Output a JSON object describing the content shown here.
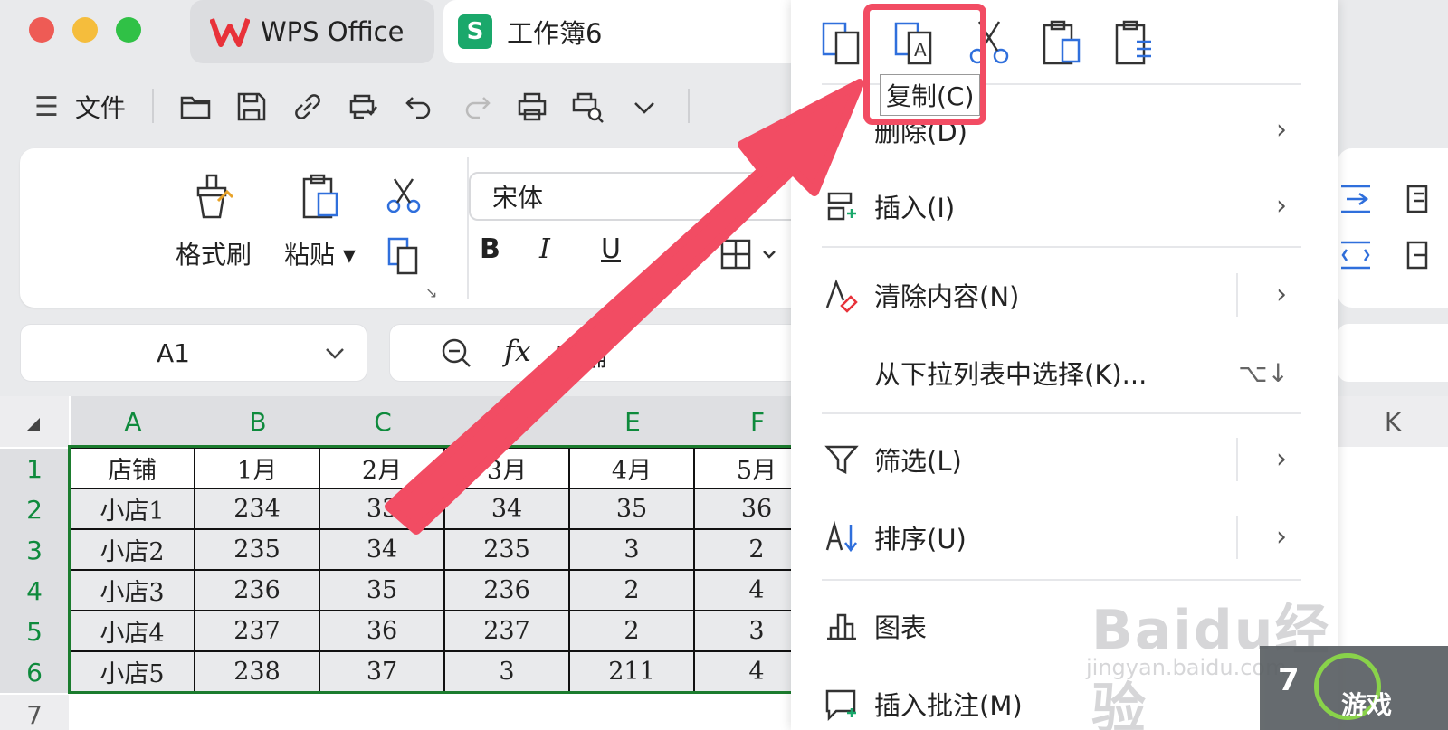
{
  "titlebar": {
    "tabs": [
      {
        "label": "WPS Office"
      },
      {
        "label": "工作簿6"
      }
    ]
  },
  "quickbar": {
    "menu_label": "文件"
  },
  "ribbon": {
    "format_painter_label": "格式刷",
    "paste_label": "粘贴",
    "font_name": "宋体",
    "bold": "B",
    "italic": "I",
    "underline": "U"
  },
  "formula_bar": {
    "cell_ref": "A1",
    "fx": "fx",
    "value": "店铺"
  },
  "sheet": {
    "columns": [
      "A",
      "B",
      "C",
      "D",
      "E",
      "F"
    ],
    "right_column": "K",
    "row_numbers": [
      "1",
      "2",
      "3",
      "4",
      "5",
      "6",
      "7"
    ],
    "rows": [
      [
        "店铺",
        "1月",
        "2月",
        "3月",
        "4月",
        "5月"
      ],
      [
        "小店1",
        "234",
        "33",
        "34",
        "35",
        "36"
      ],
      [
        "小店2",
        "235",
        "34",
        "235",
        "3",
        "2"
      ],
      [
        "小店3",
        "236",
        "35",
        "236",
        "2",
        "4"
      ],
      [
        "小店4",
        "237",
        "36",
        "237",
        "2",
        "3"
      ],
      [
        "小店5",
        "238",
        "37",
        "3",
        "211",
        "4"
      ]
    ]
  },
  "context_menu": {
    "tooltip": "复制(C)",
    "items": [
      {
        "label": "删除(D)",
        "icon": "delete-icon"
      },
      {
        "label": "插入(I)",
        "icon": "insert-icon"
      },
      {
        "label": "清除内容(N)",
        "icon": "clear-content-icon"
      },
      {
        "label": "从下拉列表中选择(K)...",
        "shortcut": "⌥↓"
      },
      {
        "label": "筛选(L)",
        "icon": "filter-icon"
      },
      {
        "label": "排序(U)",
        "icon": "sort-icon"
      },
      {
        "label": "图表",
        "icon": "chart-icon"
      },
      {
        "label": "插入批注(M)",
        "icon": "comment-icon"
      }
    ]
  },
  "watermarks": {
    "baidu": "Baidu经验",
    "baidu_url": "jingyan.baidu.com",
    "game_site": "游戏"
  },
  "colors": {
    "accent_green": "#1b7c2e",
    "header_text_green": "#0e8a3c",
    "annotation_red": "#f24c63"
  }
}
